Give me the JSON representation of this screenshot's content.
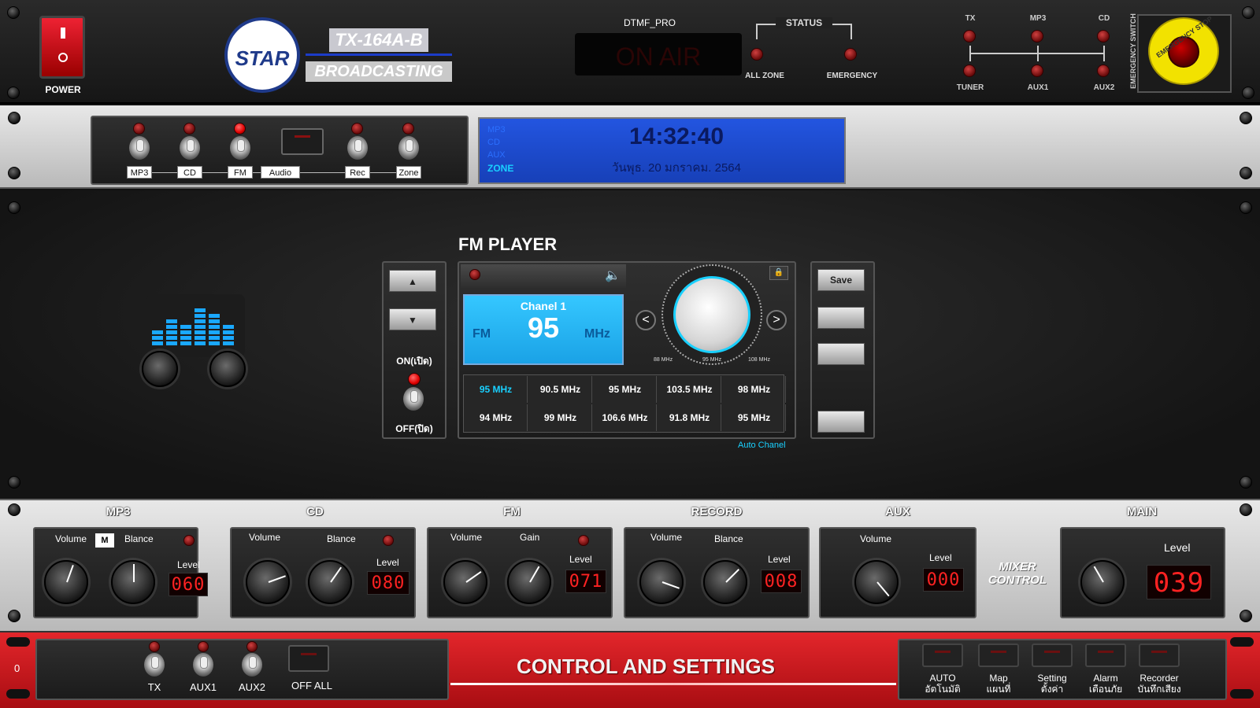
{
  "top": {
    "power_label": "POWER",
    "logo_text": "STAR",
    "model": "TX-164A-B",
    "brand": "BROADCASTING",
    "dtmf_label": "DTMF_PRO",
    "on_air": "ON AIR",
    "status_title": "STATUS",
    "status_all_zone": "ALL ZONE",
    "status_emergency": "EMERGENCY",
    "route_top": [
      "TX",
      "MP3",
      "CD"
    ],
    "route_bottom": [
      "TUNER",
      "AUX1",
      "AUX2"
    ],
    "emergency_switch_label": "EMERGENCY SWITCH",
    "emergency_stop_label": "EMERGENCY STOP"
  },
  "sources": {
    "items": [
      "MP3",
      "CD",
      "FM",
      "Audio",
      "Rec",
      "Zone"
    ],
    "active": "FM"
  },
  "display": {
    "indicators": [
      "MP3",
      "CD",
      "AUX",
      "ZONE"
    ],
    "time": "14:32:40",
    "date": "วันพุธ. 20 มกราคม. 2564"
  },
  "fm": {
    "title": "FM PLAYER",
    "on_label": "ON(เปิด)",
    "off_label": "OFF(ปิด)",
    "channel": "Chanel 1",
    "band": "FM",
    "freq": "95",
    "unit": "MHz",
    "dial_min": "88 MHz",
    "dial_mid": "95 MHz",
    "dial_max": "108 MHz",
    "presets": [
      "95 MHz",
      "90.5 MHz",
      "95 MHz",
      "103.5 MHz",
      "98 MHz",
      "94 MHz",
      "99 MHz",
      "106.6 MHz",
      "91.8 MHz",
      "95 MHz"
    ],
    "auto_label": "Auto Chanel",
    "save_label": "Save",
    "prev": "<",
    "next": ">"
  },
  "mixer": {
    "mp3": {
      "title": "MP3",
      "vol": "Volume",
      "m": "M",
      "bal": "Blance",
      "level": "Level",
      "value": "060"
    },
    "cd": {
      "title": "CD",
      "vol": "Volume",
      "bal": "Blance",
      "level": "Level",
      "value": "080"
    },
    "fm": {
      "title": "FM",
      "vol": "Volume",
      "gain": "Gain",
      "level": "Level",
      "value": "071"
    },
    "record": {
      "title": "RECORD",
      "vol": "Volume",
      "bal": "Blance",
      "level": "Level",
      "value": "008"
    },
    "aux": {
      "title": "AUX",
      "vol": "Volume",
      "level": "Level",
      "value": "000"
    },
    "main": {
      "title": "MAIN",
      "level": "Level",
      "value": "039"
    },
    "logo": "MIXER CONTROL"
  },
  "bottom": {
    "side_value": "0",
    "switches": [
      "TX",
      "AUX1",
      "AUX2"
    ],
    "off_all": "OFF ALL",
    "banner": "CONTROL AND SETTINGS",
    "buttons": [
      {
        "en": "AUTO",
        "th": "อัตโนมัติ"
      },
      {
        "en": "Map",
        "th": "แผนที่"
      },
      {
        "en": "Setting",
        "th": "ตั้งค่า"
      },
      {
        "en": "Alarm",
        "th": "เตือนภัย"
      },
      {
        "en": "Recorder",
        "th": "บันทึกเสียง"
      }
    ]
  },
  "colors": {
    "led_on": "#e00000",
    "lcd_blue": "#1f56d8",
    "accent_cyan": "#19d0ff",
    "banner_red": "#d81a1a"
  }
}
